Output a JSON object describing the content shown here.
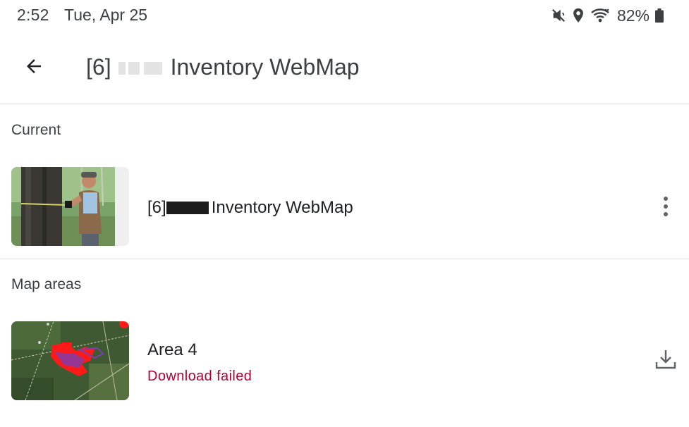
{
  "status_bar": {
    "time": "2:52",
    "date": "Tue, Apr 25",
    "battery_percent": "82%",
    "icons": [
      "vibrate-mute-icon",
      "location-icon",
      "wifi-icon",
      "battery-icon"
    ]
  },
  "app_bar": {
    "back_icon": "arrow-back-icon",
    "title_prefix": "[6]",
    "title_suffix": "Inventory WebMap"
  },
  "sections": {
    "current_label": "Current",
    "map_areas_label": "Map areas"
  },
  "current_map": {
    "name_prefix": "[6]",
    "name_suffix": "Inventory WebMap",
    "thumbnail": "person-measuring-tree-photo",
    "menu_icon": "more-vert-icon"
  },
  "map_areas": [
    {
      "name": "Area 4",
      "status": "Download failed",
      "thumbnail": "satellite-map-thumbnail",
      "action_icon": "download-icon"
    }
  ],
  "colors": {
    "status_error": "#b00037",
    "divider": "#dadce0",
    "text_primary": "#202124",
    "text_secondary": "#3c4043",
    "icon": "#5f6368"
  }
}
